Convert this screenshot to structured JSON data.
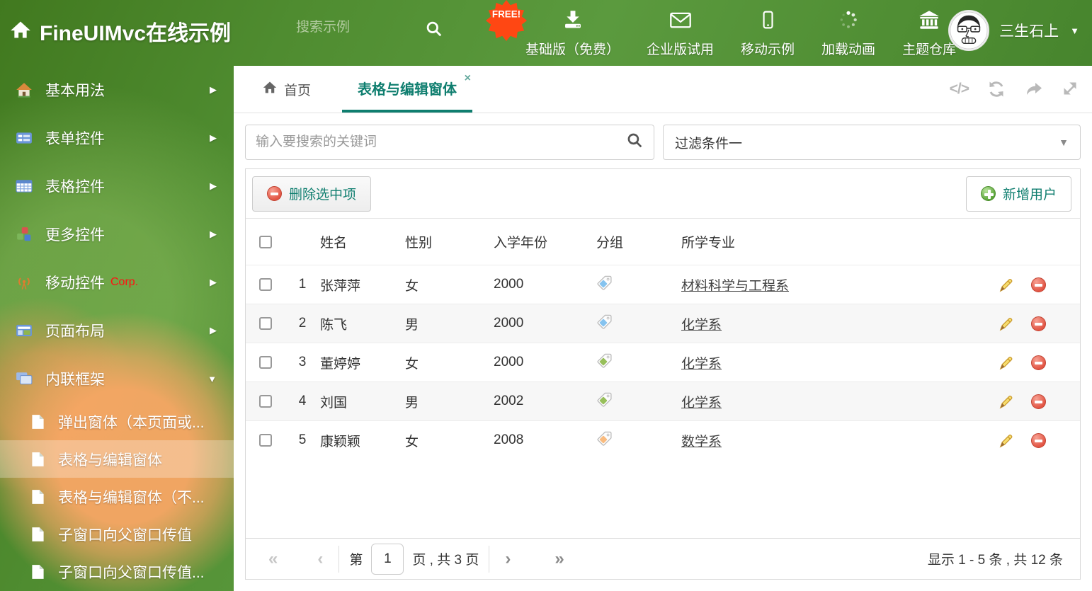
{
  "header": {
    "logo": "FineUIMvc在线示例",
    "search_placeholder": "搜索示例",
    "free_badge": "FREE!",
    "nav": [
      {
        "label": "基础版（免费）",
        "icon": "download-icon"
      },
      {
        "label": "企业版试用",
        "icon": "envelope-icon"
      },
      {
        "label": "移动示例",
        "icon": "mobile-icon"
      },
      {
        "label": "加载动画",
        "icon": "spinner-icon"
      },
      {
        "label": "主题仓库",
        "icon": "bank-icon"
      }
    ],
    "user": {
      "name": "三生石上"
    }
  },
  "sidebar": {
    "items": [
      {
        "label": "基本用法",
        "icon": "home-icon"
      },
      {
        "label": "表单控件",
        "icon": "form-icon"
      },
      {
        "label": "表格控件",
        "icon": "table-icon"
      },
      {
        "label": "更多控件",
        "icon": "cubes-icon"
      },
      {
        "label": "移动控件",
        "badge": "Corp.",
        "icon": "antenna-icon"
      },
      {
        "label": "页面布局",
        "icon": "layout-icon"
      },
      {
        "label": "内联框架",
        "icon": "frames-icon",
        "expanded": true
      }
    ],
    "subitems": [
      {
        "label": "弹出窗体（本页面或..."
      },
      {
        "label": "表格与编辑窗体",
        "selected": true
      },
      {
        "label": "表格与编辑窗体（不..."
      },
      {
        "label": "子窗口向父窗口传值"
      },
      {
        "label": "子窗口向父窗口传值..."
      }
    ]
  },
  "tabs": [
    {
      "label": "首页",
      "icon": "home-icon"
    },
    {
      "label": "表格与编辑窗体",
      "active": true,
      "closable": true
    }
  ],
  "filters": {
    "search_placeholder": "输入要搜索的关键词",
    "dropdown_value": "过滤条件一"
  },
  "grid": {
    "toolbar": {
      "delete_label": "删除选中项",
      "add_label": "新增用户"
    },
    "columns": [
      "姓名",
      "性别",
      "入学年份",
      "分组",
      "所学专业"
    ],
    "rows": [
      {
        "num": "1",
        "name": "张萍萍",
        "gender": "女",
        "year": "2000",
        "tag_color": "blue",
        "major": "材料科学与工程系"
      },
      {
        "num": "2",
        "name": "陈飞",
        "gender": "男",
        "year": "2000",
        "tag_color": "blue",
        "major": "化学系"
      },
      {
        "num": "3",
        "name": "董婷婷",
        "gender": "女",
        "year": "2000",
        "tag_color": "green",
        "major": "化学系"
      },
      {
        "num": "4",
        "name": "刘国",
        "gender": "男",
        "year": "2002",
        "tag_color": "green",
        "major": "化学系"
      },
      {
        "num": "5",
        "name": "康颖颖",
        "gender": "女",
        "year": "2008",
        "tag_color": "orange",
        "major": "数学系"
      }
    ],
    "pagination": {
      "page_prefix": "第",
      "current_page": "1",
      "page_suffix": "页 , 共 3 页",
      "summary": "显示 1 - 5 条 , 共 12 条"
    }
  },
  "icons": {
    "arrow_right": "▶",
    "caret_down": "▼",
    "tab_close": "×",
    "code": "</>",
    "pager_first": "«",
    "pager_prev": "‹",
    "pager_next": "›",
    "pager_last": "»"
  },
  "colors": {
    "accent": "#0f7e6f",
    "header_green": "#4f8c30",
    "tags": {
      "blue": "#85c3ef",
      "green": "#97bf5a",
      "orange": "#f9bb7f"
    }
  }
}
